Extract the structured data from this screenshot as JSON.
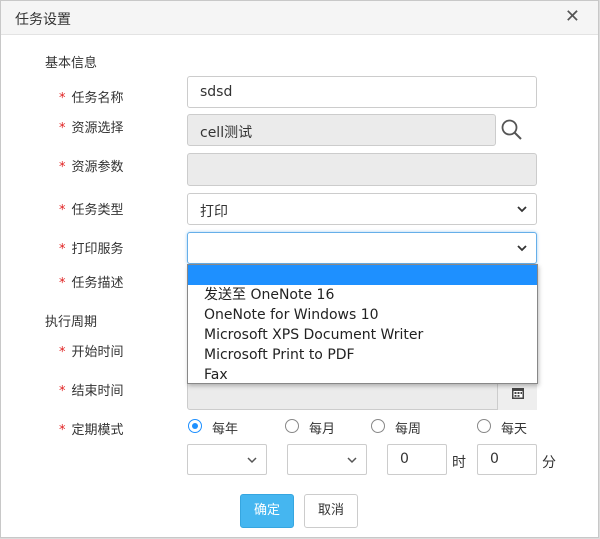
{
  "dialog": {
    "title": "任务设置"
  },
  "sections": {
    "basic": "基本信息",
    "schedule": "执行周期"
  },
  "required_mark": "*",
  "labels": {
    "task_name": "任务名称",
    "resource_select": "资源选择",
    "resource_params": "资源参数",
    "task_type": "任务类型",
    "print_service": "打印服务",
    "task_desc": "任务描述",
    "start_time": "开始时间",
    "end_time": "结束时间",
    "period_mode": "定期模式"
  },
  "fields": {
    "task_name": "sdsd",
    "resource_select": "cell测试",
    "resource_params": "",
    "task_type": "打印",
    "print_service": ""
  },
  "print_service_options": [
    "",
    "发送至 OneNote 16",
    "OneNote for Windows 10",
    "Microsoft XPS Document Writer",
    "Microsoft Print to PDF",
    "Fax"
  ],
  "period_options": [
    "每年",
    "每月",
    "每周",
    "每天"
  ],
  "period_selected": "每年",
  "time": {
    "hour": "0",
    "minute": "0",
    "hour_unit": "时",
    "minute_unit": "分"
  },
  "buttons": {
    "confirm": "确定",
    "cancel": "取消"
  },
  "colors": {
    "accent": "#1e90ff",
    "primary_button": "#45b6f0",
    "required": "#e02020"
  }
}
